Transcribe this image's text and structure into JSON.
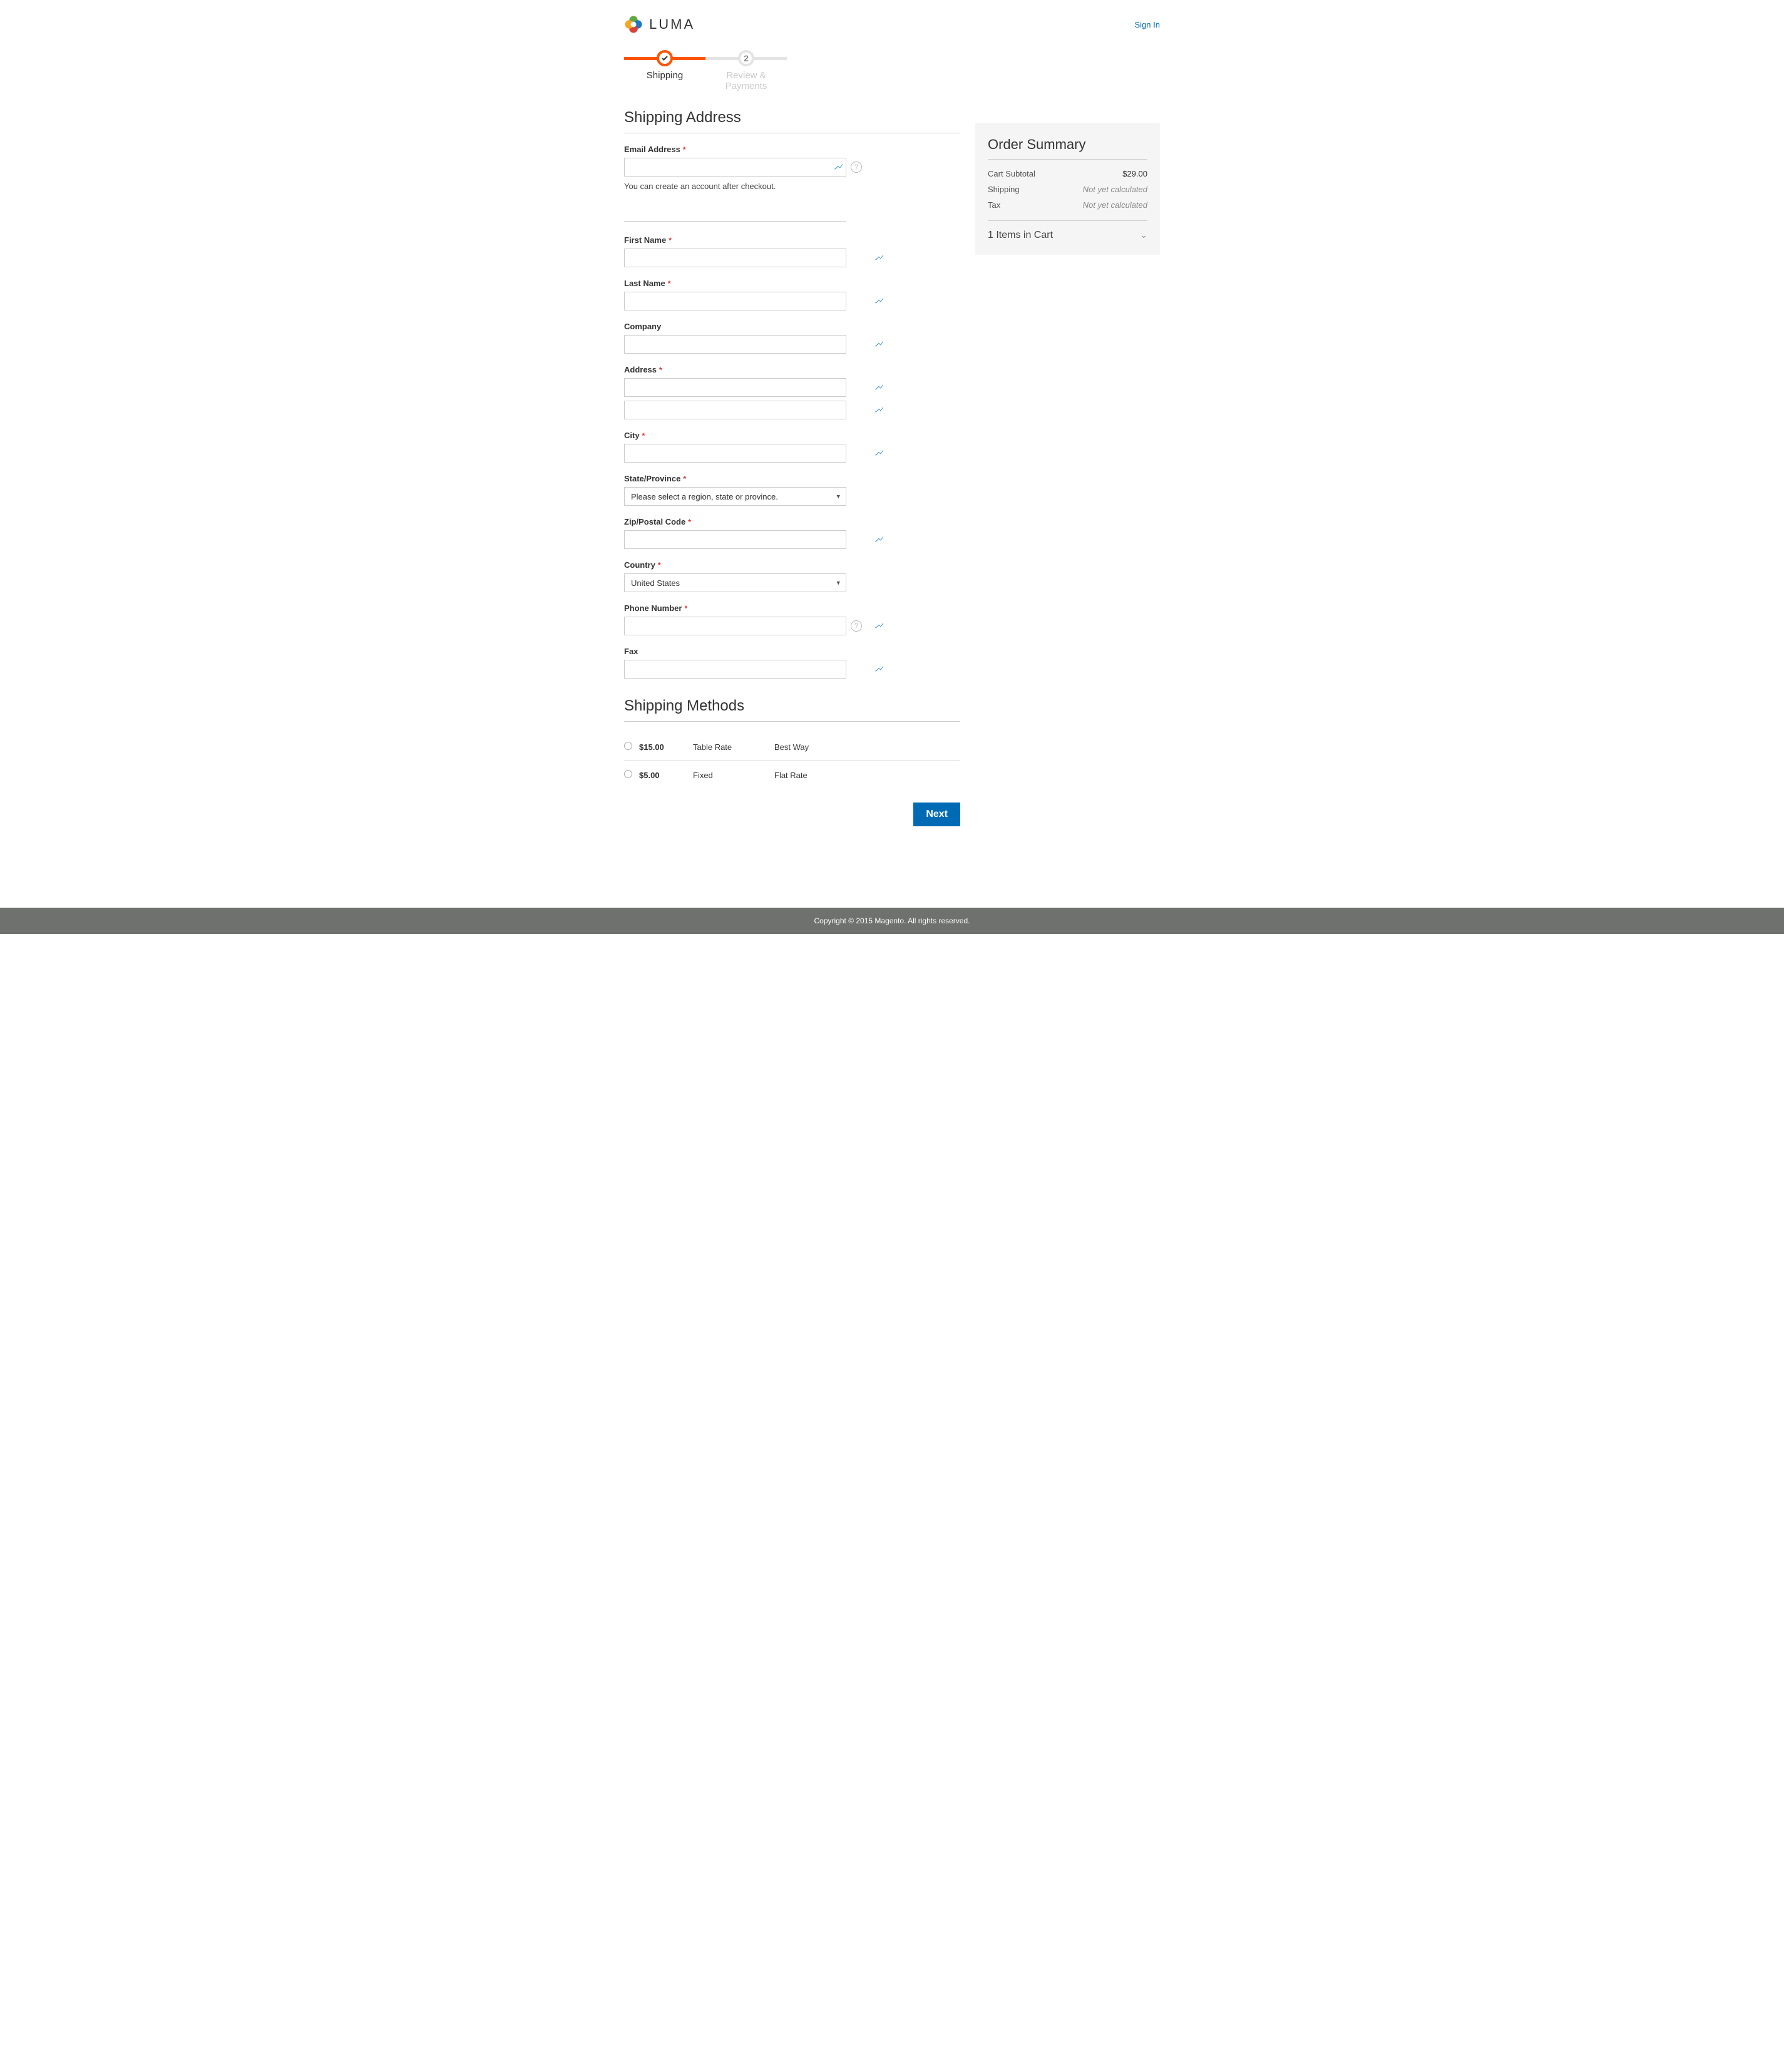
{
  "header": {
    "brand": "LUMA",
    "signin": "Sign In"
  },
  "progress": {
    "step1_label": "Shipping",
    "step2_number": "2",
    "step2_label": "Review & Payments"
  },
  "shipping": {
    "title": "Shipping Address",
    "email_label": "Email Address",
    "email_note": "You can create an account after checkout.",
    "first_name_label": "First Name",
    "last_name_label": "Last Name",
    "company_label": "Company",
    "address_label": "Address",
    "city_label": "City",
    "state_label": "State/Province",
    "state_placeholder": "Please select a region, state or province.",
    "zip_label": "Zip/Postal Code",
    "country_label": "Country",
    "country_value": "United States",
    "phone_label": "Phone Number",
    "fax_label": "Fax"
  },
  "methods": {
    "title": "Shipping Methods",
    "rows": [
      {
        "price": "$15.00",
        "name": "Table Rate",
        "carrier": "Best Way"
      },
      {
        "price": "$5.00",
        "name": "Fixed",
        "carrier": "Flat Rate"
      }
    ]
  },
  "actions": {
    "next": "Next"
  },
  "summary": {
    "title": "Order Summary",
    "subtotal_label": "Cart Subtotal",
    "subtotal_value": "$29.00",
    "shipping_label": "Shipping",
    "shipping_value": "Not yet calculated",
    "tax_label": "Tax",
    "tax_value": "Not yet calculated",
    "items_label": "1 Items in Cart"
  },
  "footer": {
    "text": "Copyright © 2015 Magento. All rights reserved."
  }
}
